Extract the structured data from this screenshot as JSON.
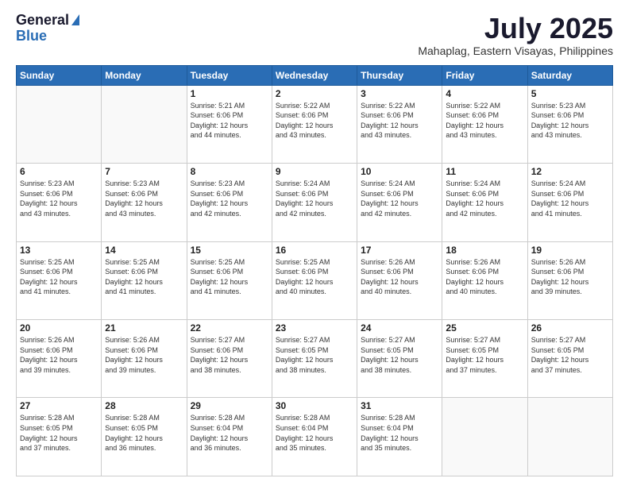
{
  "logo": {
    "general": "General",
    "blue": "Blue"
  },
  "title": "July 2025",
  "subtitle": "Mahaplag, Eastern Visayas, Philippines",
  "weekdays": [
    "Sunday",
    "Monday",
    "Tuesday",
    "Wednesday",
    "Thursday",
    "Friday",
    "Saturday"
  ],
  "weeks": [
    [
      {
        "day": "",
        "detail": ""
      },
      {
        "day": "",
        "detail": ""
      },
      {
        "day": "1",
        "detail": "Sunrise: 5:21 AM\nSunset: 6:06 PM\nDaylight: 12 hours\nand 44 minutes."
      },
      {
        "day": "2",
        "detail": "Sunrise: 5:22 AM\nSunset: 6:06 PM\nDaylight: 12 hours\nand 43 minutes."
      },
      {
        "day": "3",
        "detail": "Sunrise: 5:22 AM\nSunset: 6:06 PM\nDaylight: 12 hours\nand 43 minutes."
      },
      {
        "day": "4",
        "detail": "Sunrise: 5:22 AM\nSunset: 6:06 PM\nDaylight: 12 hours\nand 43 minutes."
      },
      {
        "day": "5",
        "detail": "Sunrise: 5:23 AM\nSunset: 6:06 PM\nDaylight: 12 hours\nand 43 minutes."
      }
    ],
    [
      {
        "day": "6",
        "detail": "Sunrise: 5:23 AM\nSunset: 6:06 PM\nDaylight: 12 hours\nand 43 minutes."
      },
      {
        "day": "7",
        "detail": "Sunrise: 5:23 AM\nSunset: 6:06 PM\nDaylight: 12 hours\nand 43 minutes."
      },
      {
        "day": "8",
        "detail": "Sunrise: 5:23 AM\nSunset: 6:06 PM\nDaylight: 12 hours\nand 42 minutes."
      },
      {
        "day": "9",
        "detail": "Sunrise: 5:24 AM\nSunset: 6:06 PM\nDaylight: 12 hours\nand 42 minutes."
      },
      {
        "day": "10",
        "detail": "Sunrise: 5:24 AM\nSunset: 6:06 PM\nDaylight: 12 hours\nand 42 minutes."
      },
      {
        "day": "11",
        "detail": "Sunrise: 5:24 AM\nSunset: 6:06 PM\nDaylight: 12 hours\nand 42 minutes."
      },
      {
        "day": "12",
        "detail": "Sunrise: 5:24 AM\nSunset: 6:06 PM\nDaylight: 12 hours\nand 41 minutes."
      }
    ],
    [
      {
        "day": "13",
        "detail": "Sunrise: 5:25 AM\nSunset: 6:06 PM\nDaylight: 12 hours\nand 41 minutes."
      },
      {
        "day": "14",
        "detail": "Sunrise: 5:25 AM\nSunset: 6:06 PM\nDaylight: 12 hours\nand 41 minutes."
      },
      {
        "day": "15",
        "detail": "Sunrise: 5:25 AM\nSunset: 6:06 PM\nDaylight: 12 hours\nand 41 minutes."
      },
      {
        "day": "16",
        "detail": "Sunrise: 5:25 AM\nSunset: 6:06 PM\nDaylight: 12 hours\nand 40 minutes."
      },
      {
        "day": "17",
        "detail": "Sunrise: 5:26 AM\nSunset: 6:06 PM\nDaylight: 12 hours\nand 40 minutes."
      },
      {
        "day": "18",
        "detail": "Sunrise: 5:26 AM\nSunset: 6:06 PM\nDaylight: 12 hours\nand 40 minutes."
      },
      {
        "day": "19",
        "detail": "Sunrise: 5:26 AM\nSunset: 6:06 PM\nDaylight: 12 hours\nand 39 minutes."
      }
    ],
    [
      {
        "day": "20",
        "detail": "Sunrise: 5:26 AM\nSunset: 6:06 PM\nDaylight: 12 hours\nand 39 minutes."
      },
      {
        "day": "21",
        "detail": "Sunrise: 5:26 AM\nSunset: 6:06 PM\nDaylight: 12 hours\nand 39 minutes."
      },
      {
        "day": "22",
        "detail": "Sunrise: 5:27 AM\nSunset: 6:06 PM\nDaylight: 12 hours\nand 38 minutes."
      },
      {
        "day": "23",
        "detail": "Sunrise: 5:27 AM\nSunset: 6:05 PM\nDaylight: 12 hours\nand 38 minutes."
      },
      {
        "day": "24",
        "detail": "Sunrise: 5:27 AM\nSunset: 6:05 PM\nDaylight: 12 hours\nand 38 minutes."
      },
      {
        "day": "25",
        "detail": "Sunrise: 5:27 AM\nSunset: 6:05 PM\nDaylight: 12 hours\nand 37 minutes."
      },
      {
        "day": "26",
        "detail": "Sunrise: 5:27 AM\nSunset: 6:05 PM\nDaylight: 12 hours\nand 37 minutes."
      }
    ],
    [
      {
        "day": "27",
        "detail": "Sunrise: 5:28 AM\nSunset: 6:05 PM\nDaylight: 12 hours\nand 37 minutes."
      },
      {
        "day": "28",
        "detail": "Sunrise: 5:28 AM\nSunset: 6:05 PM\nDaylight: 12 hours\nand 36 minutes."
      },
      {
        "day": "29",
        "detail": "Sunrise: 5:28 AM\nSunset: 6:04 PM\nDaylight: 12 hours\nand 36 minutes."
      },
      {
        "day": "30",
        "detail": "Sunrise: 5:28 AM\nSunset: 6:04 PM\nDaylight: 12 hours\nand 35 minutes."
      },
      {
        "day": "31",
        "detail": "Sunrise: 5:28 AM\nSunset: 6:04 PM\nDaylight: 12 hours\nand 35 minutes."
      },
      {
        "day": "",
        "detail": ""
      },
      {
        "day": "",
        "detail": ""
      }
    ]
  ]
}
